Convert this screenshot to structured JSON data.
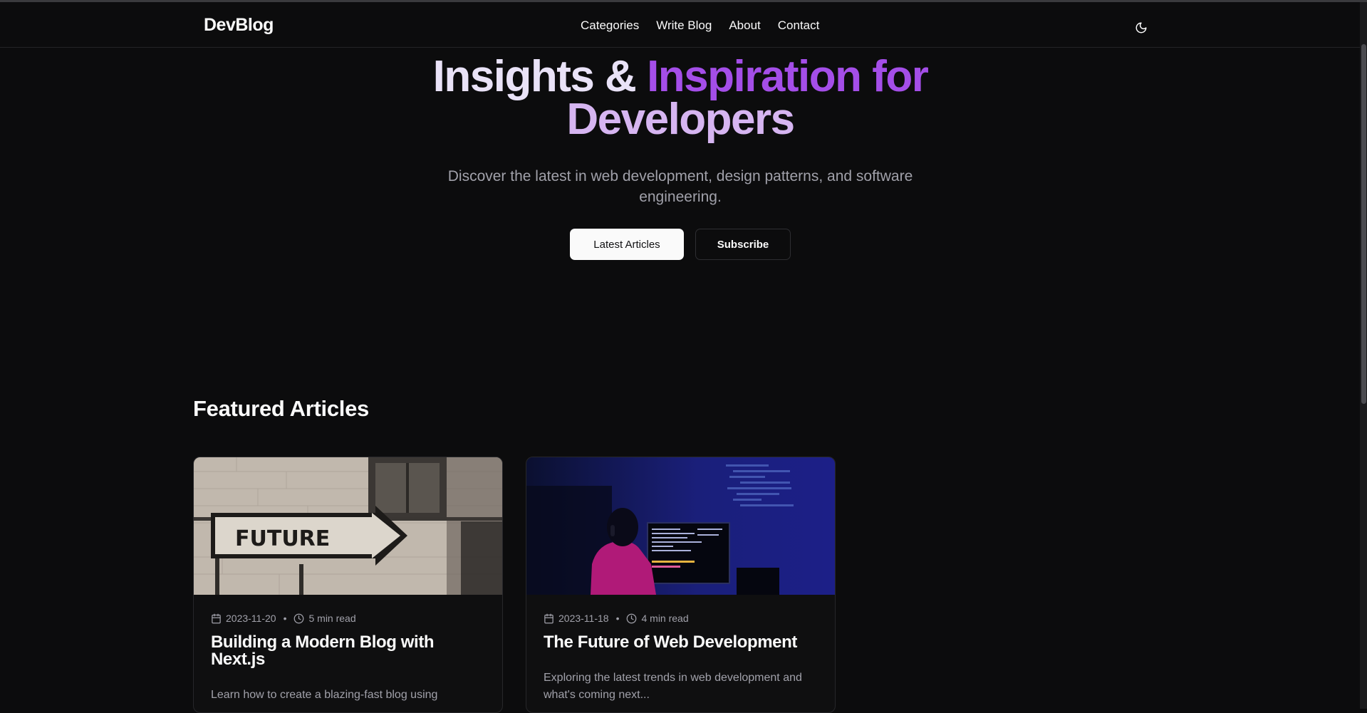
{
  "navbar": {
    "brand": "DevBlog",
    "links": [
      "Categories",
      "Write Blog",
      "About",
      "Contact"
    ],
    "theme_toggle_icon": "moon-icon"
  },
  "hero": {
    "title_part1": "Insights & ",
    "title_part2": "Inspiration for",
    "title_part3": "Developers",
    "subtitle": "Discover the latest in web development, design patterns, and software engineering.",
    "primary_button": "Latest Articles",
    "secondary_button": "Subscribe",
    "colors": {
      "light": "#e9e2f7",
      "purple": "#a44ee8",
      "lavender": "#d6b5f1"
    }
  },
  "featured": {
    "heading": "Featured Articles",
    "articles": [
      {
        "date": "2023-11-20",
        "read_time": "5 min read",
        "title": "Building a Modern Blog with Next.js",
        "excerpt": "Learn how to create a blazing-fast blog using",
        "image_text": "FUTURE"
      },
      {
        "date": "2023-11-18",
        "read_time": "4 min read",
        "title": "The Future of Web Development",
        "excerpt": "Exploring the latest trends in web development and what's coming next..."
      }
    ]
  }
}
